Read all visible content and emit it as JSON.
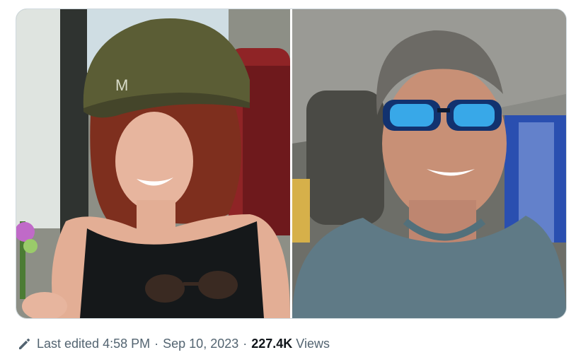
{
  "post": {
    "media": [
      {
        "kind": "photo",
        "icon": "photo-woman-helmet"
      },
      {
        "kind": "photo",
        "icon": "photo-man-sunglasses"
      }
    ],
    "meta": {
      "edit_icon": "pencil-icon",
      "edited_label": "Last edited",
      "time": "4:58 PM",
      "separator": "·",
      "date": "Sep 10, 2023",
      "views_count": "227.4K",
      "views_label": "Views"
    }
  }
}
